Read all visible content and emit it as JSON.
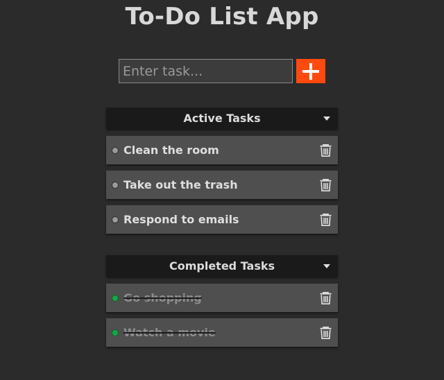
{
  "app": {
    "title": "To-Do List App"
  },
  "input": {
    "placeholder": "Enter task...",
    "value": ""
  },
  "add_button": {
    "icon": "plus-icon",
    "color": "#ff4a0f"
  },
  "active_section": {
    "title": "Active Tasks",
    "icon": "chevron-down-icon",
    "tasks": [
      {
        "label": "Clean the room"
      },
      {
        "label": "Take out the trash"
      },
      {
        "label": "Respond to emails"
      }
    ]
  },
  "completed_section": {
    "title": "Completed Tasks",
    "icon": "chevron-down-icon",
    "tasks": [
      {
        "label": "Go shopping"
      },
      {
        "label": "Watch a movie"
      }
    ]
  },
  "colors": {
    "background": "#2b2b2b",
    "card": "#4f4f4f",
    "header": "#1a1a1a",
    "accent": "#ff4a0f",
    "done_dot": "#1aa34a"
  }
}
